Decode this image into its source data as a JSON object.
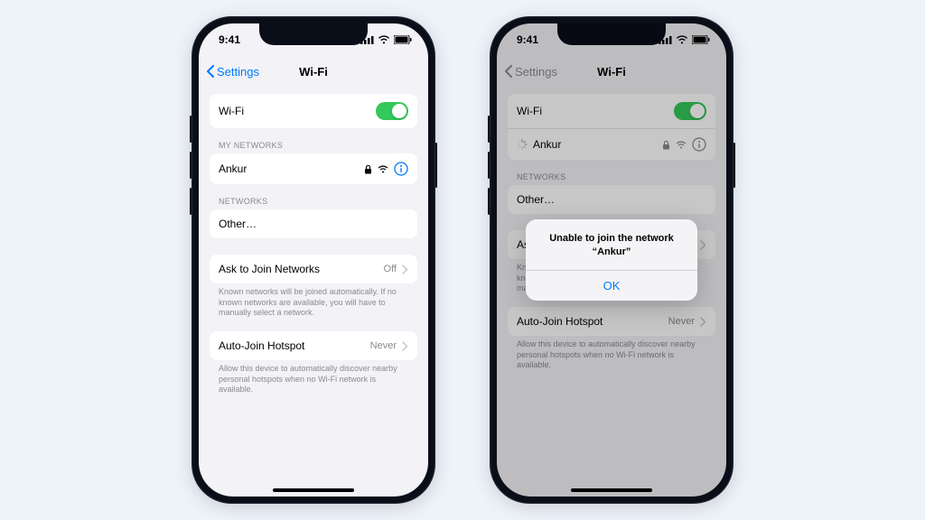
{
  "status": {
    "time": "9:41"
  },
  "nav": {
    "back": "Settings",
    "title": "Wi-Fi"
  },
  "left": {
    "wifi_label": "Wi-Fi",
    "my_networks_header": "MY NETWORKS",
    "network_name": "Ankur",
    "networks_header": "NETWORKS",
    "other_label": "Other…",
    "ask_label": "Ask to Join Networks",
    "ask_value": "Off",
    "ask_footer": "Known networks will be joined automatically. If no known networks are available, you will have to manually select a network.",
    "hotspot_label": "Auto-Join Hotspot",
    "hotspot_value": "Never",
    "hotspot_footer": "Allow this device to automatically discover nearby personal hotspots when no Wi-Fi network is available."
  },
  "right": {
    "wifi_label": "Wi-Fi",
    "network_name": "Ankur",
    "networks_header": "NETWORKS",
    "other_label": "Other…",
    "ask_label": "Ask to Join Networks",
    "ask_footer_partial": "Known networks will be joined automatically. If no known networks are available, you will have to manually select a network.",
    "hotspot_label": "Auto-Join Hotspot",
    "hotspot_value": "Never",
    "hotspot_footer": "Allow this device to automatically discover nearby personal hotspots when no Wi-Fi network is available.",
    "alert_title": "Unable to join the network “Ankur”",
    "alert_ok": "OK"
  }
}
